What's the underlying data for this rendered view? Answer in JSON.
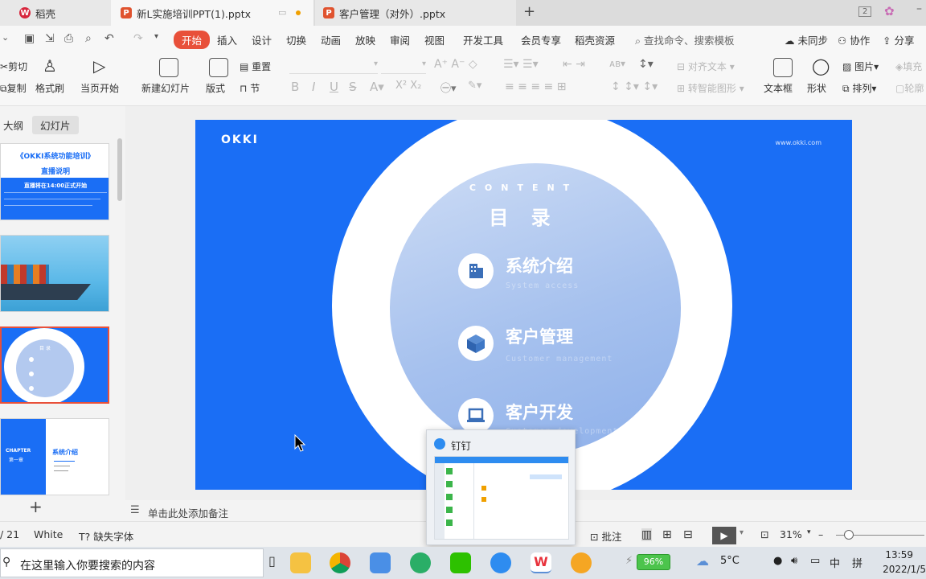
{
  "tabs": {
    "home": "稻壳",
    "active_doc": "新L实施培训PPT(1).pptx",
    "second_doc": "客户管理（对外）.pptx",
    "window_badge": "2"
  },
  "menu": {
    "items": [
      "开始",
      "插入",
      "设计",
      "切换",
      "动画",
      "放映",
      "审阅",
      "视图",
      "开发工具",
      "会员专享",
      "稻壳资源"
    ],
    "search": "查找命令、搜索模板",
    "unsynced": "未同步",
    "collab": "协作",
    "share": "分享"
  },
  "ribbon": {
    "cut": "剪切",
    "copy": "复制",
    "format_painter": "格式刷",
    "play_from_current": "当页开始",
    "new_slide": "新建幻灯片",
    "layout": "版式",
    "reset": "重置",
    "section": "节",
    "align_text": "对齐文本",
    "smartart": "转智能图形",
    "textbox": "文本框",
    "shape": "形状",
    "picture": "图片",
    "arrange": "排列",
    "fill": "填充",
    "outline": "轮廓"
  },
  "left_pane": {
    "outline_tab": "大纲",
    "slides_tab": "幻灯片",
    "thumb1_title": "《OKKI系统功能培训》",
    "thumb1_subtitle": "直播说明",
    "thumb1_banner": "直播将在14:00正式开始",
    "thumb3_title": "目 录",
    "thumb4_chapter": "CHAPTER",
    "thumb4_chapter_no": "第一章",
    "thumb4_title": "系统介绍",
    "add": "+"
  },
  "slide": {
    "logo": "OKKI",
    "url": "www.okki.com",
    "content_en": "CONTENT",
    "content_cn": "目 录",
    "items": [
      {
        "title": "系统介绍",
        "subtitle": "System access"
      },
      {
        "title": "客户管理",
        "subtitle": "Customer management"
      },
      {
        "title": "客户开发",
        "subtitle": "Customer development"
      }
    ]
  },
  "preview": {
    "app": "钉钉"
  },
  "note": "单击此处添加备注",
  "status": {
    "page": "/ 21",
    "theme": "White",
    "missing_font": "缺失字体",
    "comment": "批注",
    "zoom": "31%"
  },
  "taskbar": {
    "search_placeholder": "在这里输入你要搜索的内容",
    "battery": "96%",
    "weather": "5°C",
    "ime_lang": "中",
    "ime_mode": "拼",
    "time": "13:59",
    "date": "2022/1/5"
  },
  "colors": {
    "accent": "#e8503a",
    "slide_blue": "#1a6ef5"
  }
}
